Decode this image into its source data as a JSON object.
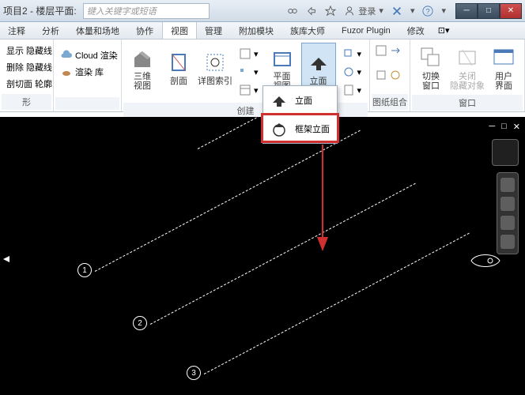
{
  "title": "项目2 - 楼层平面:",
  "search": {
    "placeholder": "键入关键字或短语"
  },
  "login_label": "登录",
  "menu": {
    "tabs": [
      "注释",
      "分析",
      "体量和场地",
      "协作",
      "视图",
      "管理",
      "附加模块",
      "族库大师",
      "Fuzor Plugin",
      "修改"
    ],
    "active": "视图"
  },
  "ribbon": {
    "group_shape": {
      "label": "形",
      "items": [
        "显示 隐藏线",
        "删除 隐藏线",
        "剖切面 轮廓"
      ]
    },
    "group_render": {
      "label": "",
      "cloud": "Cloud 渲染",
      "lib": "渲染 库"
    },
    "group_create": {
      "label": "创建",
      "threeD": "三维\n视图",
      "section": "剖面",
      "detail": "详图索引",
      "plan": "平面\n视图",
      "elev": "立面"
    },
    "group_sheet": {
      "label": "图纸组合"
    },
    "group_window": {
      "label": "窗口",
      "switch": "切换\n窗口",
      "close": "关闭\n隐藏对象",
      "ui": "用户\n界面"
    }
  },
  "dropdown": {
    "item1": "立面",
    "item2": "框架立面"
  },
  "gridlines": [
    "1",
    "2",
    "3"
  ]
}
